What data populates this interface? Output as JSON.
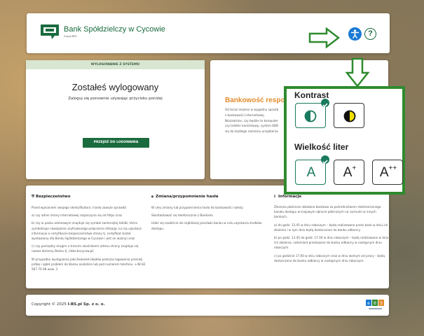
{
  "header": {
    "bank_name": "Bank Spółdzielczy w Cycowie",
    "bank_subtitle": "Grupa BPS",
    "accessibility_icon": "accessibility-icon",
    "help_icon": "help-icon",
    "help_symbol": "?"
  },
  "logout": {
    "section_title": "WYLOGOWANIE Z SYSTEMU",
    "title": "Zostałeś wylogowany",
    "subtitle": "Zaloguj się ponownie używając przycisku poniżej",
    "button_label": "PRZEJDŹ DO LOGOWANIA"
  },
  "info_card": {
    "title": "Bankowość respon",
    "lines": [
      "Od teraz możesz w wygodny sposób",
      "z bankowości internetowej.",
      "Niezależnie, czy będzie to komputer",
      "czy telefon komórkowy, system EBO",
      "się do każdego rozmiaru urządzenia"
    ]
  },
  "bottom": {
    "security": {
      "heading": "Bezpieczeństwo",
      "paragraphs": [
        "Przed wpisaniem swojego identyfikatora i hasła zawsze sprawdź:",
        "a) czy adres strony internetowej rozpoczyna się od https oraz",
        "b) czy w pasku adresowym znajduje się symbol zamkniętej kłódki, która symbolizuje nawiązanie szyfrowanego połączenia (klikając na nią uzyskasz informacje o certyfikacie bezpieczeństwa strony tj. certyfikat został wystawiony dla Banku Spółdzielczego w Cycowie i jest on ważny) oraz",
        "c) czy pomiędzy drugim a trzecim ukośnikiem adresu strony znajduje się nazwa domeny Banku tj. //ebo.bscycow.pl/",
        "W przypadku wystąpienia jakichkolwiek błędów podczas logowania przerwij próbę i zgłoś problem do Banku osobiście lub pod numerem telefonu: +48 82 567 70 08 wew. 3"
      ]
    },
    "password": {
      "heading": "Zmiana/przypomnienie hasła",
      "paragraphs": [
        "W celu zmiany lub przypomnienia hasła do bankowości należy:",
        "Skontaktować się telefonicznie z Bankiem.",
        "Udać się osobiście do najbliższej placówki banku w celu uzyskania środków dostępu."
      ]
    },
    "info": {
      "heading": "Informacje",
      "paragraphs": [
        "Zlecenia płatnicze składane bankowo za pośrednictwem elektronicznego kanału dostępu w krajowym obrocie płatniczym na rachunki w innych bankach.",
        "a) do godz. 13.45 w dniu roboczym – będą realizowane przez bank w dniu ich złożenia i w tym dniu będą dostarczone do banku odbiorcy.",
        "b) po godz. 13.45 do godz. 17.00 w dniu roboczym – będą realizowane w dniu ich złożenia, natomiast przekazane do banku odbiorcy w następnym dniu roboczym",
        "c) po godzinie 17.00 w dniu roboczym oraz w dniu wolnym od pracy – będą dostarczone do banku odbiorcy w następnym dniu roboczym."
      ]
    }
  },
  "footer": {
    "copyright_prefix": "Copyright © 2025 ",
    "company": "I-BS.pl Sp. z o. o.",
    "ebs_logo_label": "eBS"
  },
  "accessibility_panel": {
    "contrast_label": "Kontrast",
    "font_size_label": "Wielkość liter",
    "font_sizes": [
      "A",
      "A",
      "A"
    ],
    "font_size_marks": [
      "",
      "+",
      "++"
    ],
    "selected_contrast": 0,
    "selected_font_size": 0
  },
  "colors": {
    "brand_green": "#1a6b3e",
    "accent_orange": "#e38b2c",
    "annotation_green": "#2e8b2e",
    "accessibility_blue": "#1a7ad4"
  }
}
